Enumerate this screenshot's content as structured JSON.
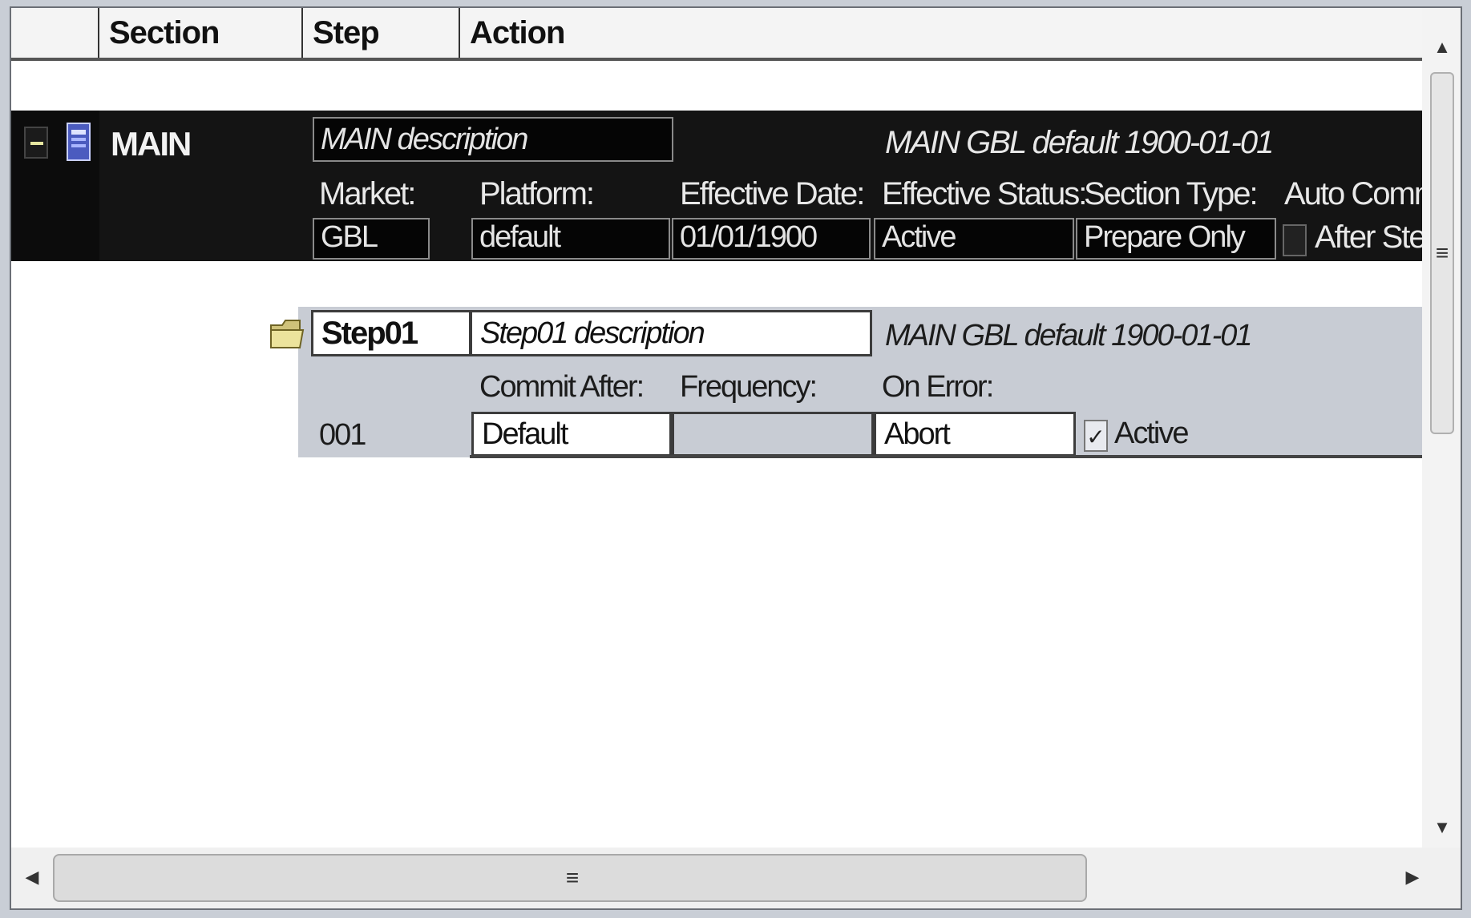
{
  "columns": {
    "col1": "",
    "section": "Section",
    "step": "Step",
    "action": "Action"
  },
  "section": {
    "name": "MAIN",
    "description": "MAIN description",
    "summary": "MAIN GBL default 1900-01-01",
    "labels": {
      "market": "Market:",
      "platform": "Platform:",
      "effective_date": "Effective Date:",
      "effective_status": "Effective Status:",
      "section_type": "Section Type:",
      "auto_commit": "Auto Commit:"
    },
    "values": {
      "market": "GBL",
      "platform": "default",
      "effective_date": "01/01/1900",
      "effective_status": "Active",
      "section_type": "Prepare Only",
      "after_step": "After Step"
    },
    "after_step_checked": false
  },
  "step": {
    "name": "Step01",
    "description": "Step01 description",
    "summary": "MAIN GBL default 1900-01-01",
    "number": "001",
    "labels": {
      "commit_after": "Commit After:",
      "frequency": "Frequency:",
      "on_error": "On Error:"
    },
    "values": {
      "commit_after": "Default",
      "frequency": "",
      "on_error": "Abort",
      "active": "Active"
    },
    "active_checked": true
  },
  "icons": {
    "collapse": "minus-icon",
    "section": "section-icon",
    "step": "folder-icon"
  },
  "scroll": {
    "up": "▲",
    "down": "▼",
    "left": "◀",
    "right": "▶",
    "grip": "≡"
  }
}
